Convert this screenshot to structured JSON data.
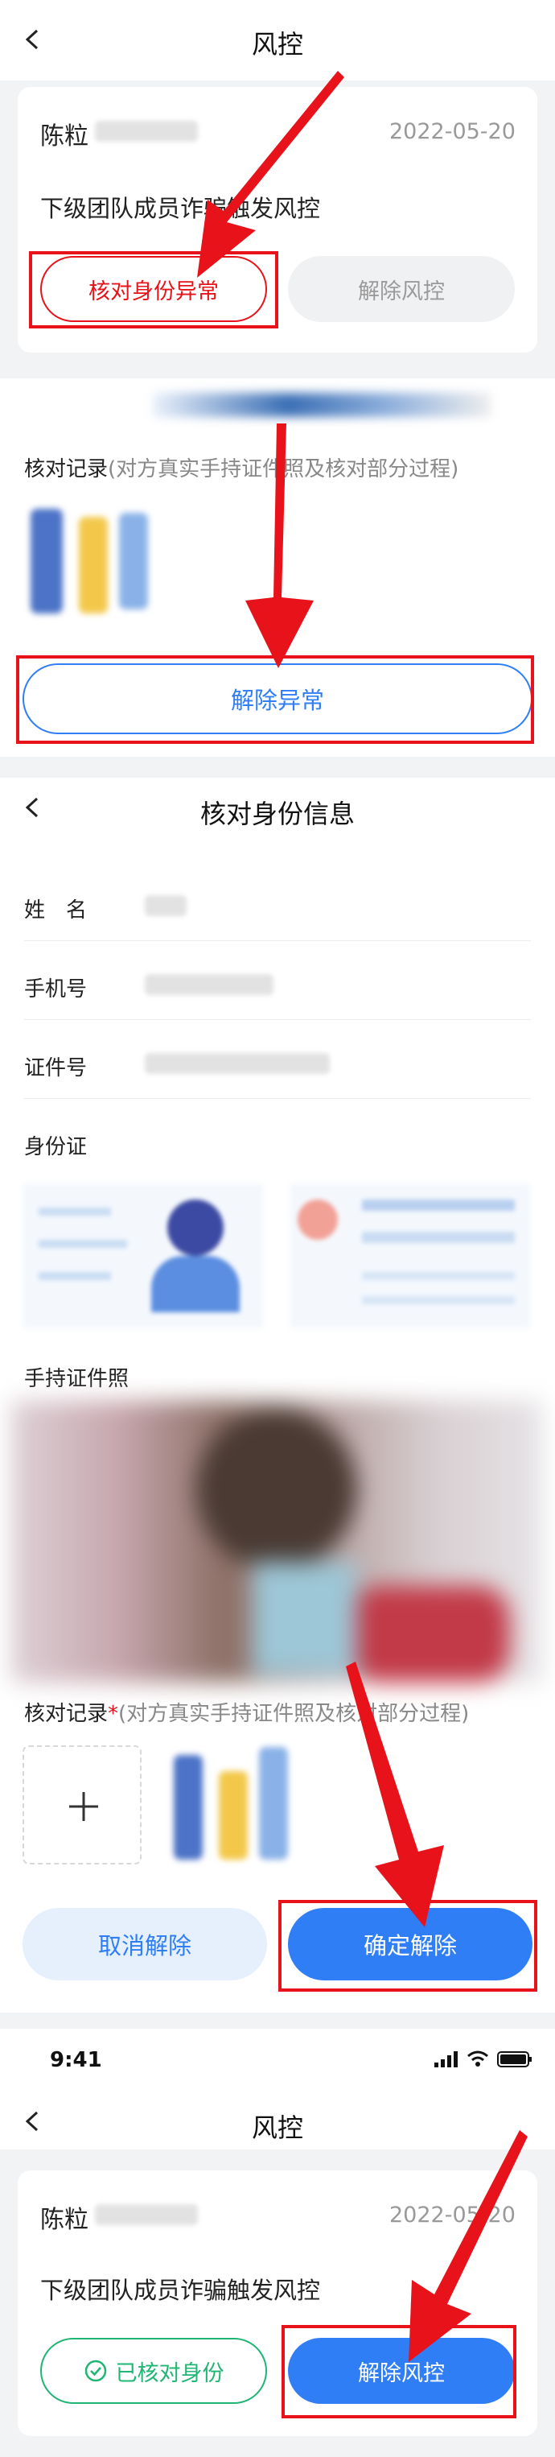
{
  "screen1": {
    "title": "风控",
    "user_name": "陈粒",
    "date": "2022-05-20",
    "description": "下级团队成员诈骗触发风控",
    "verify_button": "核对身份异常",
    "release_button": "解除风控"
  },
  "screen2": {
    "records_label": "核对记录",
    "records_hint": "(对方真实手持证件照及核对部分过程)",
    "cancel_abnormal_button": "解除异常"
  },
  "screen3": {
    "title": "核对身份信息",
    "fields": [
      {
        "label": "姓　名"
      },
      {
        "label": "手机号"
      },
      {
        "label": "证件号"
      }
    ],
    "id_card_label": "身份证",
    "handheld_label": "手持证件照",
    "records_label": "核对记录",
    "records_star": "*",
    "records_hint": "(对方真实手持证件照及核对部分过程)",
    "cancel_button": "取消解除",
    "confirm_button": "确定解除"
  },
  "screen4": {
    "time": "9:41",
    "title": "风控",
    "user_name": "陈粒",
    "date": "2022-05-20",
    "description": "下级团队成员诈骗触发风控",
    "verified_button": "已核对身份",
    "release_button": "解除风控"
  },
  "colors": {
    "primary_blue": "#2f7ef5",
    "alert_red": "#e8131a",
    "success_green": "#1fb573"
  },
  "icons": [
    "back-arrow-icon",
    "plus-icon",
    "check-circle-icon",
    "signal-icon",
    "wifi-icon",
    "battery-icon"
  ]
}
